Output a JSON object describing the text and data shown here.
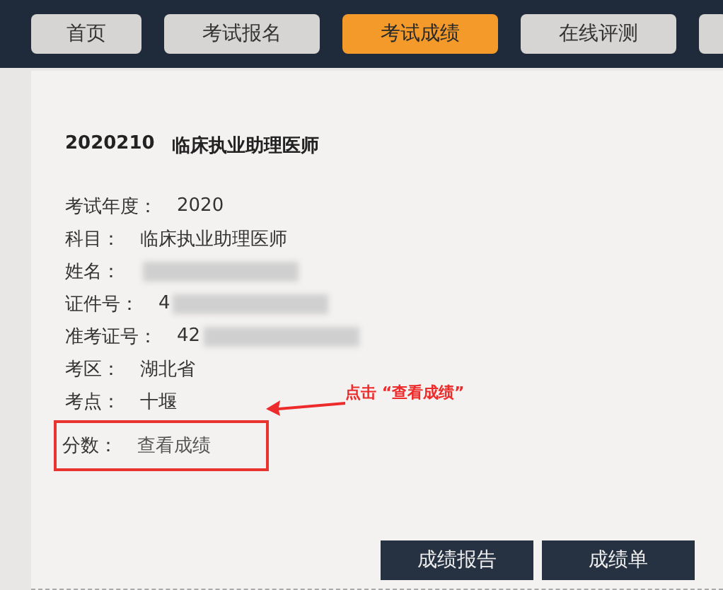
{
  "tabs": [
    {
      "label": "首页",
      "selected": false
    },
    {
      "label": "考试报名",
      "selected": false
    },
    {
      "label": "考试成绩",
      "selected": true
    },
    {
      "label": "在线评测",
      "selected": false
    }
  ],
  "exam_title": {
    "code": "2020210",
    "name": "临床执业助理医师"
  },
  "fields": [
    {
      "label": "考试年度：",
      "value": "2020",
      "redacted": false,
      "kind": "text",
      "highlighted": false
    },
    {
      "label": "科目：",
      "value": "临床执业助理医师",
      "redacted": false,
      "kind": "text",
      "highlighted": false
    },
    {
      "label": "姓名：",
      "redacted": true,
      "kind": "text",
      "highlighted": false
    },
    {
      "label": "证件号：",
      "value": "4",
      "redacted": true,
      "kind": "text",
      "highlighted": false
    },
    {
      "label": "准考证号：",
      "value": "42",
      "redacted": true,
      "kind": "text",
      "highlighted": false
    },
    {
      "label": "考区：",
      "value": "湖北省",
      "redacted": false,
      "kind": "text",
      "highlighted": false
    },
    {
      "label": "考点：",
      "value": "十堰",
      "redacted": false,
      "kind": "text",
      "highlighted": false
    },
    {
      "label": "分数：",
      "value": "查看成绩",
      "redacted": false,
      "kind": "link",
      "highlighted": true
    }
  ],
  "annotation": "点击 “查看成绩”",
  "buttons": [
    "成绩报告",
    "成绩单"
  ]
}
